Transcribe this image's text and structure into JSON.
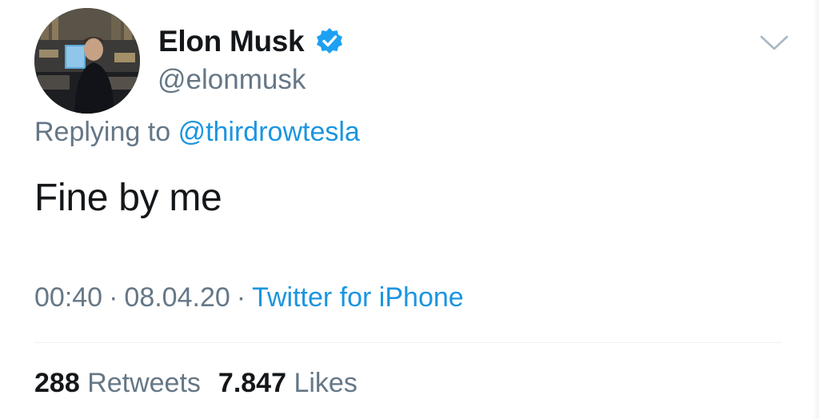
{
  "author": {
    "name": "Elon Musk",
    "handle": "@elonmusk",
    "verified": true,
    "avatar_icon": "profile-photo"
  },
  "reply": {
    "prefix": "Replying to",
    "mention": "@thirdrowtesla"
  },
  "tweet": {
    "text": "Fine by me"
  },
  "meta": {
    "time": "00:40",
    "separator": "·",
    "date": "08.04.20",
    "source": "Twitter for iPhone"
  },
  "stats": {
    "retweets_count": "288",
    "retweets_label": "Retweets",
    "likes_count": "7.847",
    "likes_label": "Likes"
  },
  "colors": {
    "link": "#1b95e0",
    "secondary_text": "#657786",
    "primary_text": "#14171a",
    "verified_badge": "#1da1f2"
  },
  "icons": {
    "verified": "verified-badge-icon",
    "menu": "chevron-down-icon"
  }
}
